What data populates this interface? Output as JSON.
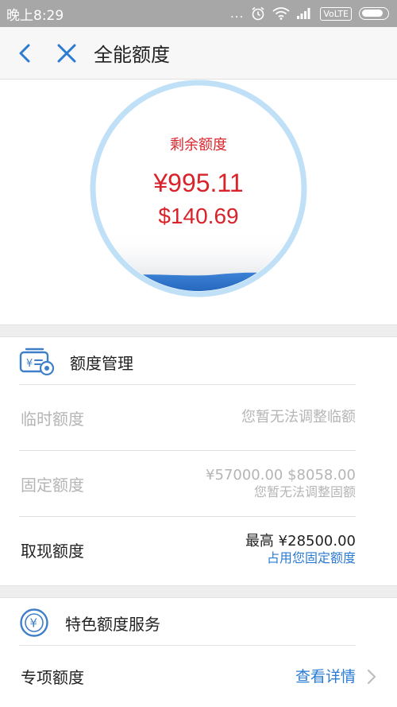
{
  "status_bar": {
    "time": "晚上8:29",
    "dots": "...",
    "network": "VoLTE"
  },
  "nav": {
    "title": "全能额度",
    "back_icon": "chevron-left-icon",
    "close_icon": "close-icon"
  },
  "quota": {
    "label": "剩余额度",
    "rmb_amount": "¥995.11",
    "usd_amount": "$140.69",
    "wave_level": 0.08
  },
  "management": {
    "title": "额度管理",
    "icon": "yen-card-gear-icon",
    "rows": [
      {
        "label": "临时额度",
        "value": "",
        "note": "您暂无法调整临额"
      },
      {
        "label": "固定额度",
        "value": "¥57000.00 $8058.00",
        "note": "您暂无法调整固额"
      },
      {
        "label": "取现额度",
        "value": "最高 ¥28500.00",
        "note": "占用您固定额度"
      }
    ]
  },
  "special": {
    "title": "特色额度服务",
    "icon": "yen-coin-icon",
    "row": {
      "label": "专项额度",
      "link": "查看详情"
    }
  },
  "colors": {
    "accent_red": "#d9232a",
    "link_blue": "#2b7bd3",
    "circle_border": "#bfe0f7",
    "wave_blue": "#3b82d6"
  }
}
